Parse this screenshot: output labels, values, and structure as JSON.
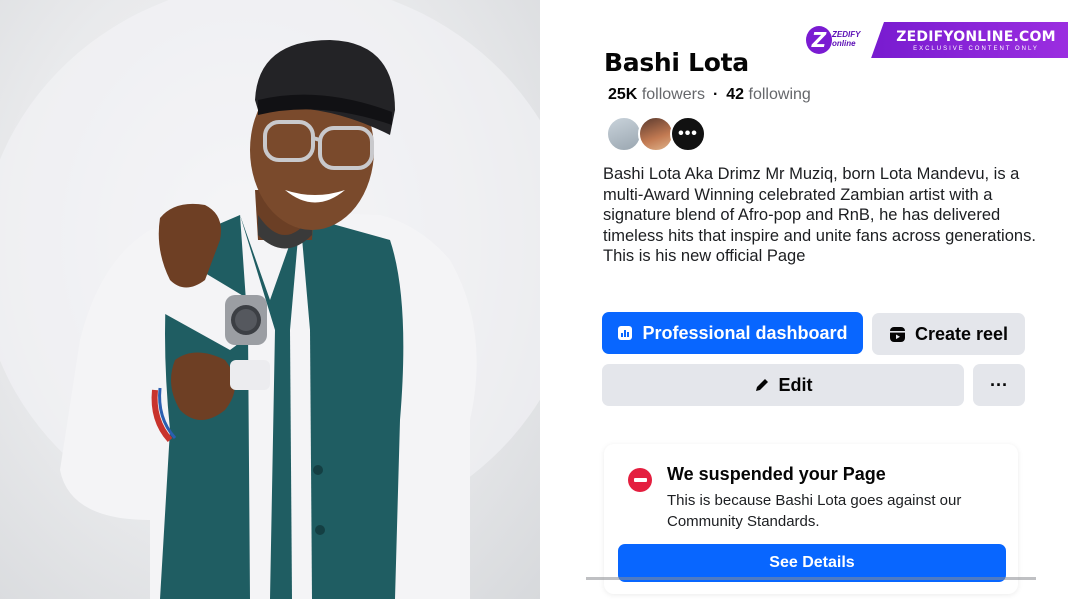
{
  "profile": {
    "name": "Bashi Lota",
    "followers_count": "25K",
    "followers_label": "followers",
    "following_count": "42",
    "following_label": "following",
    "mutuals_more": "•••",
    "bio": "Bashi Lota Aka Drimz Mr Muziq, born Lota Mandevu, is a multi-Award Winning celebrated Zambian artist with a signature blend of Afro-pop and RnB, he has delivered timeless hits that inspire and unite fans across generations. This is his new official Page"
  },
  "actions": {
    "dashboard_label": "Professional dashboard",
    "reel_label": "Create reel",
    "edit_label": "Edit",
    "more_label": "···"
  },
  "suspension": {
    "title": "We suspended your Page",
    "body": "This is because Bashi Lota goes against our Community Standards.",
    "button_label": "See Details"
  },
  "watermark": {
    "logo_letter": "Z",
    "logo_small": "ZEDIFY online",
    "title": "ZEDIFYONLINE.COM",
    "subtitle": "EXCLUSIVE CONTENT ONLY"
  },
  "colors": {
    "primary_blue": "#0866ff",
    "button_gray": "#e4e6eb",
    "alert_red": "#e41e3f",
    "watermark_purple": "#7a1bd2"
  },
  "icons": [
    "dashboard-icon",
    "reel-icon",
    "pencil-icon",
    "stop-icon"
  ]
}
